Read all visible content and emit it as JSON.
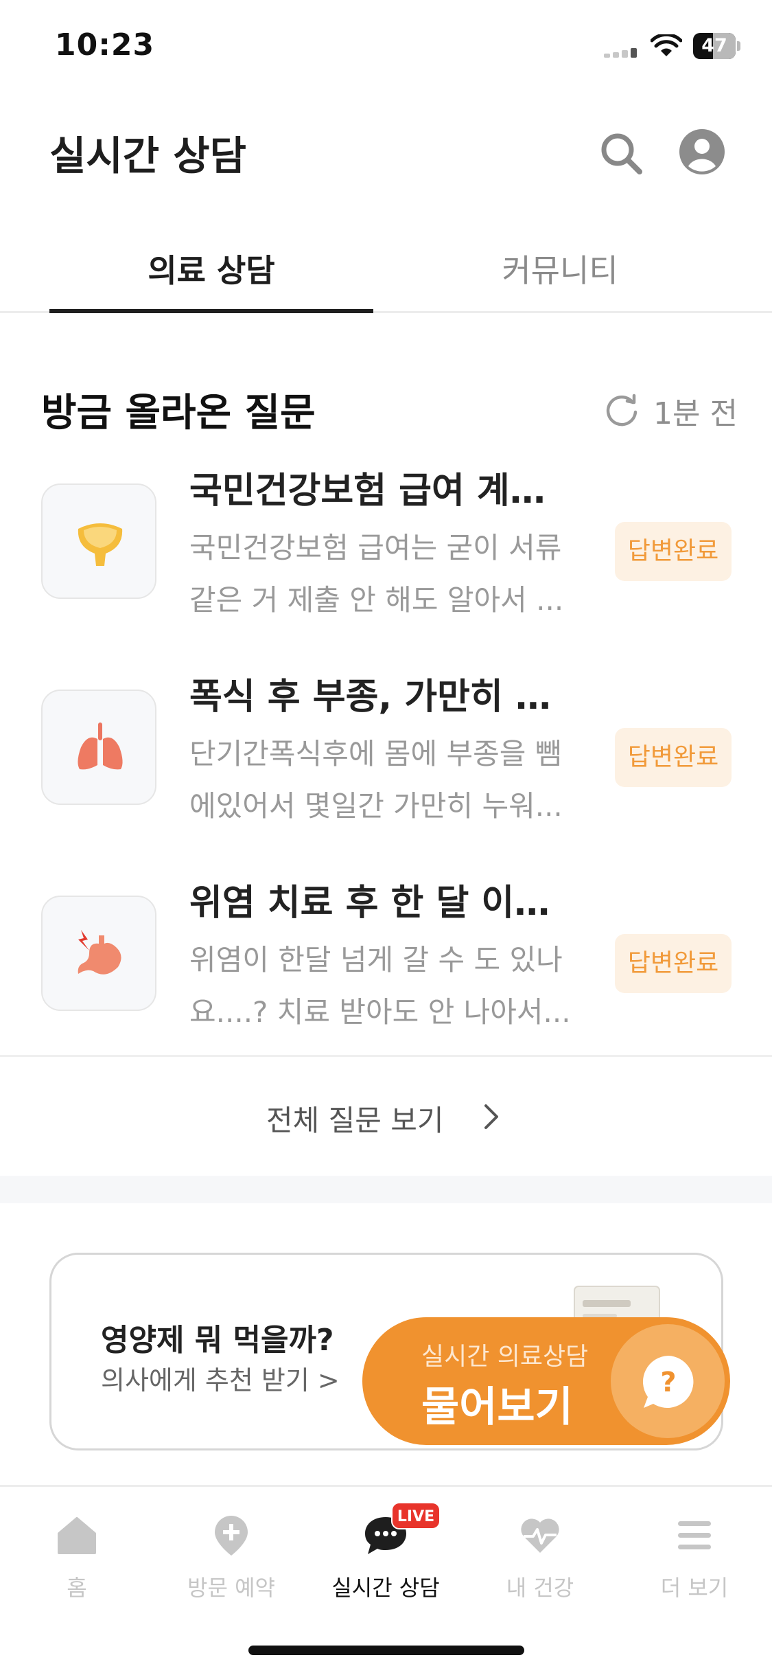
{
  "status_bar": {
    "time": "10:23",
    "battery": "47",
    "battery_level": 0.47
  },
  "header": {
    "title": "실시간 상담",
    "search_icon": "search-icon",
    "profile_icon": "profile-icon"
  },
  "tabs": [
    {
      "label": "의료 상담",
      "active": true
    },
    {
      "label": "커뮤니티",
      "active": false
    }
  ],
  "section": {
    "title": "방금 올라온 질문",
    "refresh_icon": "refresh-icon",
    "updated": "1분 전"
  },
  "questions": [
    {
      "icon": "bladder-icon",
      "title": "국민건강보험 급여 계산...",
      "preview_line1": "국민건강보험 급여는 굳이 서류",
      "preview_line2": "같은 거 제출 안 해도 알아서 ...",
      "badge": "답변완료"
    },
    {
      "icon": "lungs-icon",
      "title": "폭식 후 부종, 가만히 누...",
      "preview_line1": "단기간폭식후에 몸에 부종을 뺌",
      "preview_line2": "에있어서 몇일간 가만히 누워...",
      "badge": "답변완료"
    },
    {
      "icon": "stomach-icon",
      "title": "위염 치료 후 한 달 이상 ...",
      "preview_line1": "위염이 한달 넘게 갈 수 도 있나",
      "preview_line2": "요....? 치료 받아도 안 나아서...",
      "badge": "답변완료"
    }
  ],
  "view_all": {
    "label": "전체 질문 보기",
    "icon": "chevron-right-icon"
  },
  "banner": {
    "title": "영양제 뭐 먹을까?",
    "subtitle": "의사에게 추천 받기 >"
  },
  "ask_button": {
    "subtitle": "실시간 의료상담",
    "label": "물어보기",
    "icon": "question-bubble-icon"
  },
  "bottom_nav": [
    {
      "label": "홈",
      "icon": "home-icon",
      "active": false
    },
    {
      "label": "방문 예약",
      "icon": "location-plus-icon",
      "active": false
    },
    {
      "label": "실시간 상담",
      "icon": "chat-bubble-icon",
      "active": true,
      "badge": "LIVE"
    },
    {
      "label": "내 건강",
      "icon": "heart-pulse-icon",
      "active": false
    },
    {
      "label": "더 보기",
      "icon": "menu-icon",
      "active": false
    }
  ],
  "colors": {
    "accent": "#f0922f",
    "badge_bg": "#fdf1e3",
    "badge_text": "#f19a3a",
    "live": "#e8342b"
  }
}
